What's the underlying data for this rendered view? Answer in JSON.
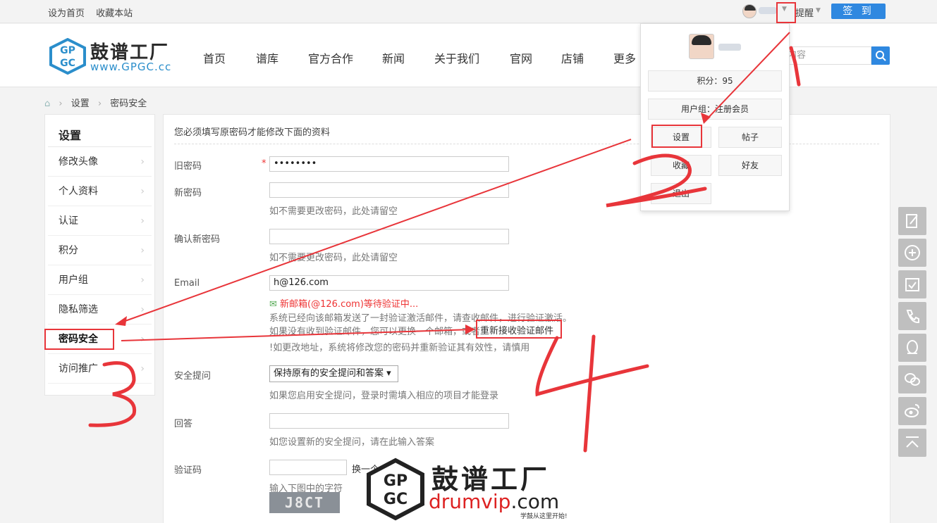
{
  "topbar": {
    "links": [
      "设为首页",
      "收藏本站"
    ],
    "remind_label": "提醒",
    "checkin_label": "签 到"
  },
  "logo": {
    "title": "鼓谱工厂",
    "url": "www.GPGC.cc"
  },
  "nav": {
    "items": [
      "首页",
      "谱库",
      "官方合作",
      "新闻",
      "关于我们",
      "官网",
      "店铺",
      "更多"
    ]
  },
  "search": {
    "placeholder": "内容"
  },
  "breadcrumb": {
    "items": [
      "设置",
      "密码安全"
    ]
  },
  "sidebar": {
    "title": "设置",
    "items": [
      "修改头像",
      "个人资料",
      "认证",
      "积分",
      "用户组",
      "隐私筛选",
      "密码安全",
      "访问推广"
    ],
    "active_index": 6
  },
  "form": {
    "notice": "您必须填写原密码才能修改下面的资料",
    "old_password_label": "旧密码",
    "old_password_value": "••••••••",
    "new_password_label": "新密码",
    "new_password_hint": "如不需要更改密码，此处请留空",
    "confirm_label": "确认新密码",
    "confirm_hint": "如不需要更改密码，此处请留空",
    "email_label": "Email",
    "email_value": "h@126.com",
    "email_pending": "新邮箱(@126.com)等待验证中...",
    "email_sent": "系统已经向该邮箱发送了一封验证激活邮件，请查收邮件，进行验证激活。",
    "email_no_receive": "如果没有收到验证邮件，您可以更换一个邮箱，或者",
    "email_resend": "重新接收验证邮件",
    "email_warning": "!如更改地址，系统将修改您的密码并重新验证其有效性，请慎用",
    "question_label": "安全提问",
    "question_value": "保持原有的安全提问和答案 ▾",
    "question_hint": "如果您启用安全提问，登录时需填入相应的项目才能登录",
    "answer_label": "回答",
    "answer_hint": "如您设置新的安全提问，请在此输入答案",
    "captcha_label": "验证码",
    "captcha_change": "换一个",
    "captcha_hint": "输入下图中的字符",
    "captcha_text": "J8CT"
  },
  "dropdown": {
    "points": "积分：95",
    "group": "用户组：注册会员",
    "buttons": [
      "设置",
      "帖子",
      "收藏",
      "好友",
      "退出"
    ]
  },
  "watermark": {
    "title": "鼓谱工厂",
    "url_main": "drumvip",
    "url_suffix": ".com",
    "slogan": "学鼓从这里开始!"
  },
  "annotations": [
    "1",
    "2",
    "3",
    "4"
  ],
  "colors": {
    "accent": "#2f88e0",
    "annotation": "#e8353a",
    "required": "#e33"
  },
  "right_tools": [
    "edit-icon",
    "plus-circle-icon",
    "calendar-check-icon",
    "phone-icon",
    "qq-icon",
    "wechat-icon",
    "weibo-icon",
    "back-to-top-icon"
  ]
}
